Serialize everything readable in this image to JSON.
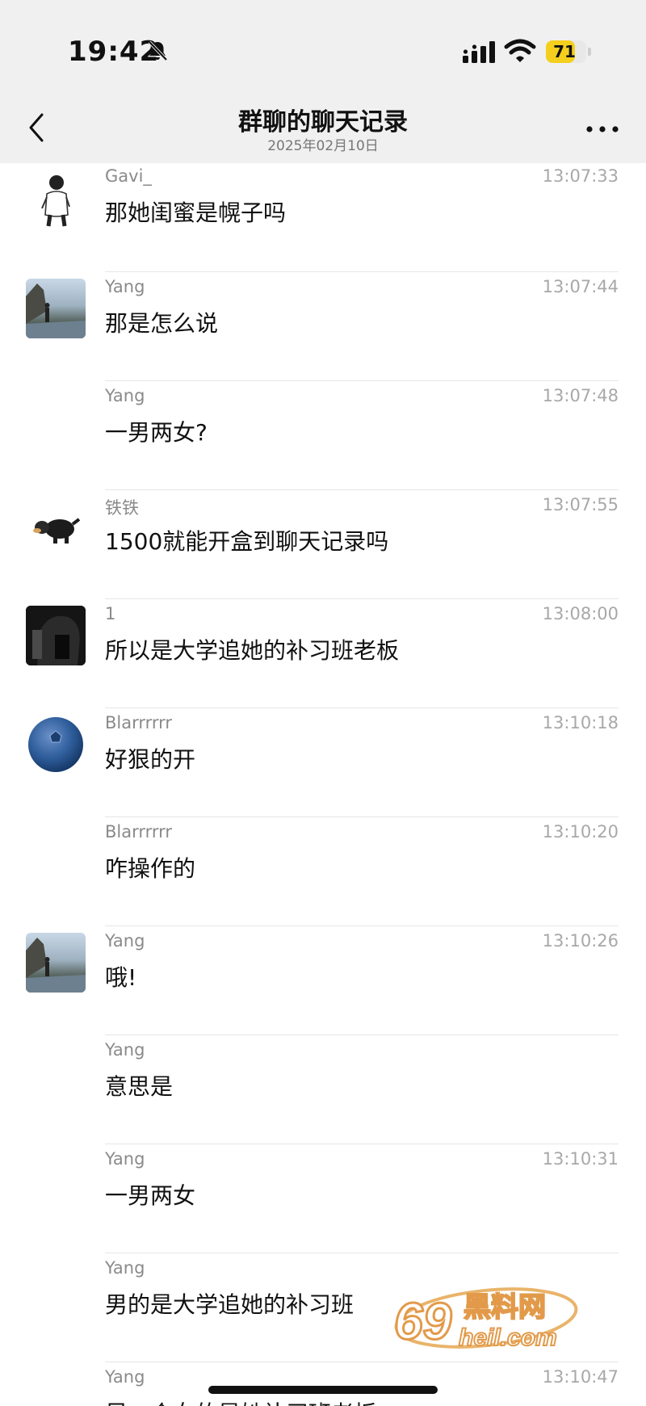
{
  "status_bar": {
    "time": "19:42",
    "battery": "71",
    "battery_level": 0.71
  },
  "nav": {
    "title": "群聊的聊天记录",
    "date": "2025年02月10日"
  },
  "messages": [
    {
      "name": "Gavi_",
      "time": "13:07:33",
      "text": "那她闺蜜是幌子吗"
    },
    {
      "name": "Yang",
      "time": "13:07:44",
      "text": "那是怎么说"
    },
    {
      "name": "Yang",
      "time": "13:07:48",
      "text": "一男两女?"
    },
    {
      "name": "铁铁",
      "time": "13:07:55",
      "text": "1500就能开盒到聊天记录吗"
    },
    {
      "name": "1",
      "time": "13:08:00",
      "text": "所以是大学追她的补习班老板"
    },
    {
      "name": "Blarrrrrr",
      "time": "13:10:18",
      "text": "好狠的开"
    },
    {
      "name": "Blarrrrrr",
      "time": "13:10:20",
      "text": "咋操作的"
    },
    {
      "name": "Yang",
      "time": "13:10:26",
      "text": "哦!"
    },
    {
      "name": "Yang",
      "time": "",
      "text": "意思是"
    },
    {
      "name": "Yang",
      "time": "13:10:31",
      "text": "一男两女"
    },
    {
      "name": "Yang",
      "time": "",
      "text": "男的是大学追她的补习班"
    },
    {
      "name": "Yang",
      "time": "13:10:47",
      "text": "另一个女的是她补习班老板"
    }
  ],
  "watermark": {
    "number": "69",
    "name": "黑料网",
    "url": "heil.com"
  }
}
